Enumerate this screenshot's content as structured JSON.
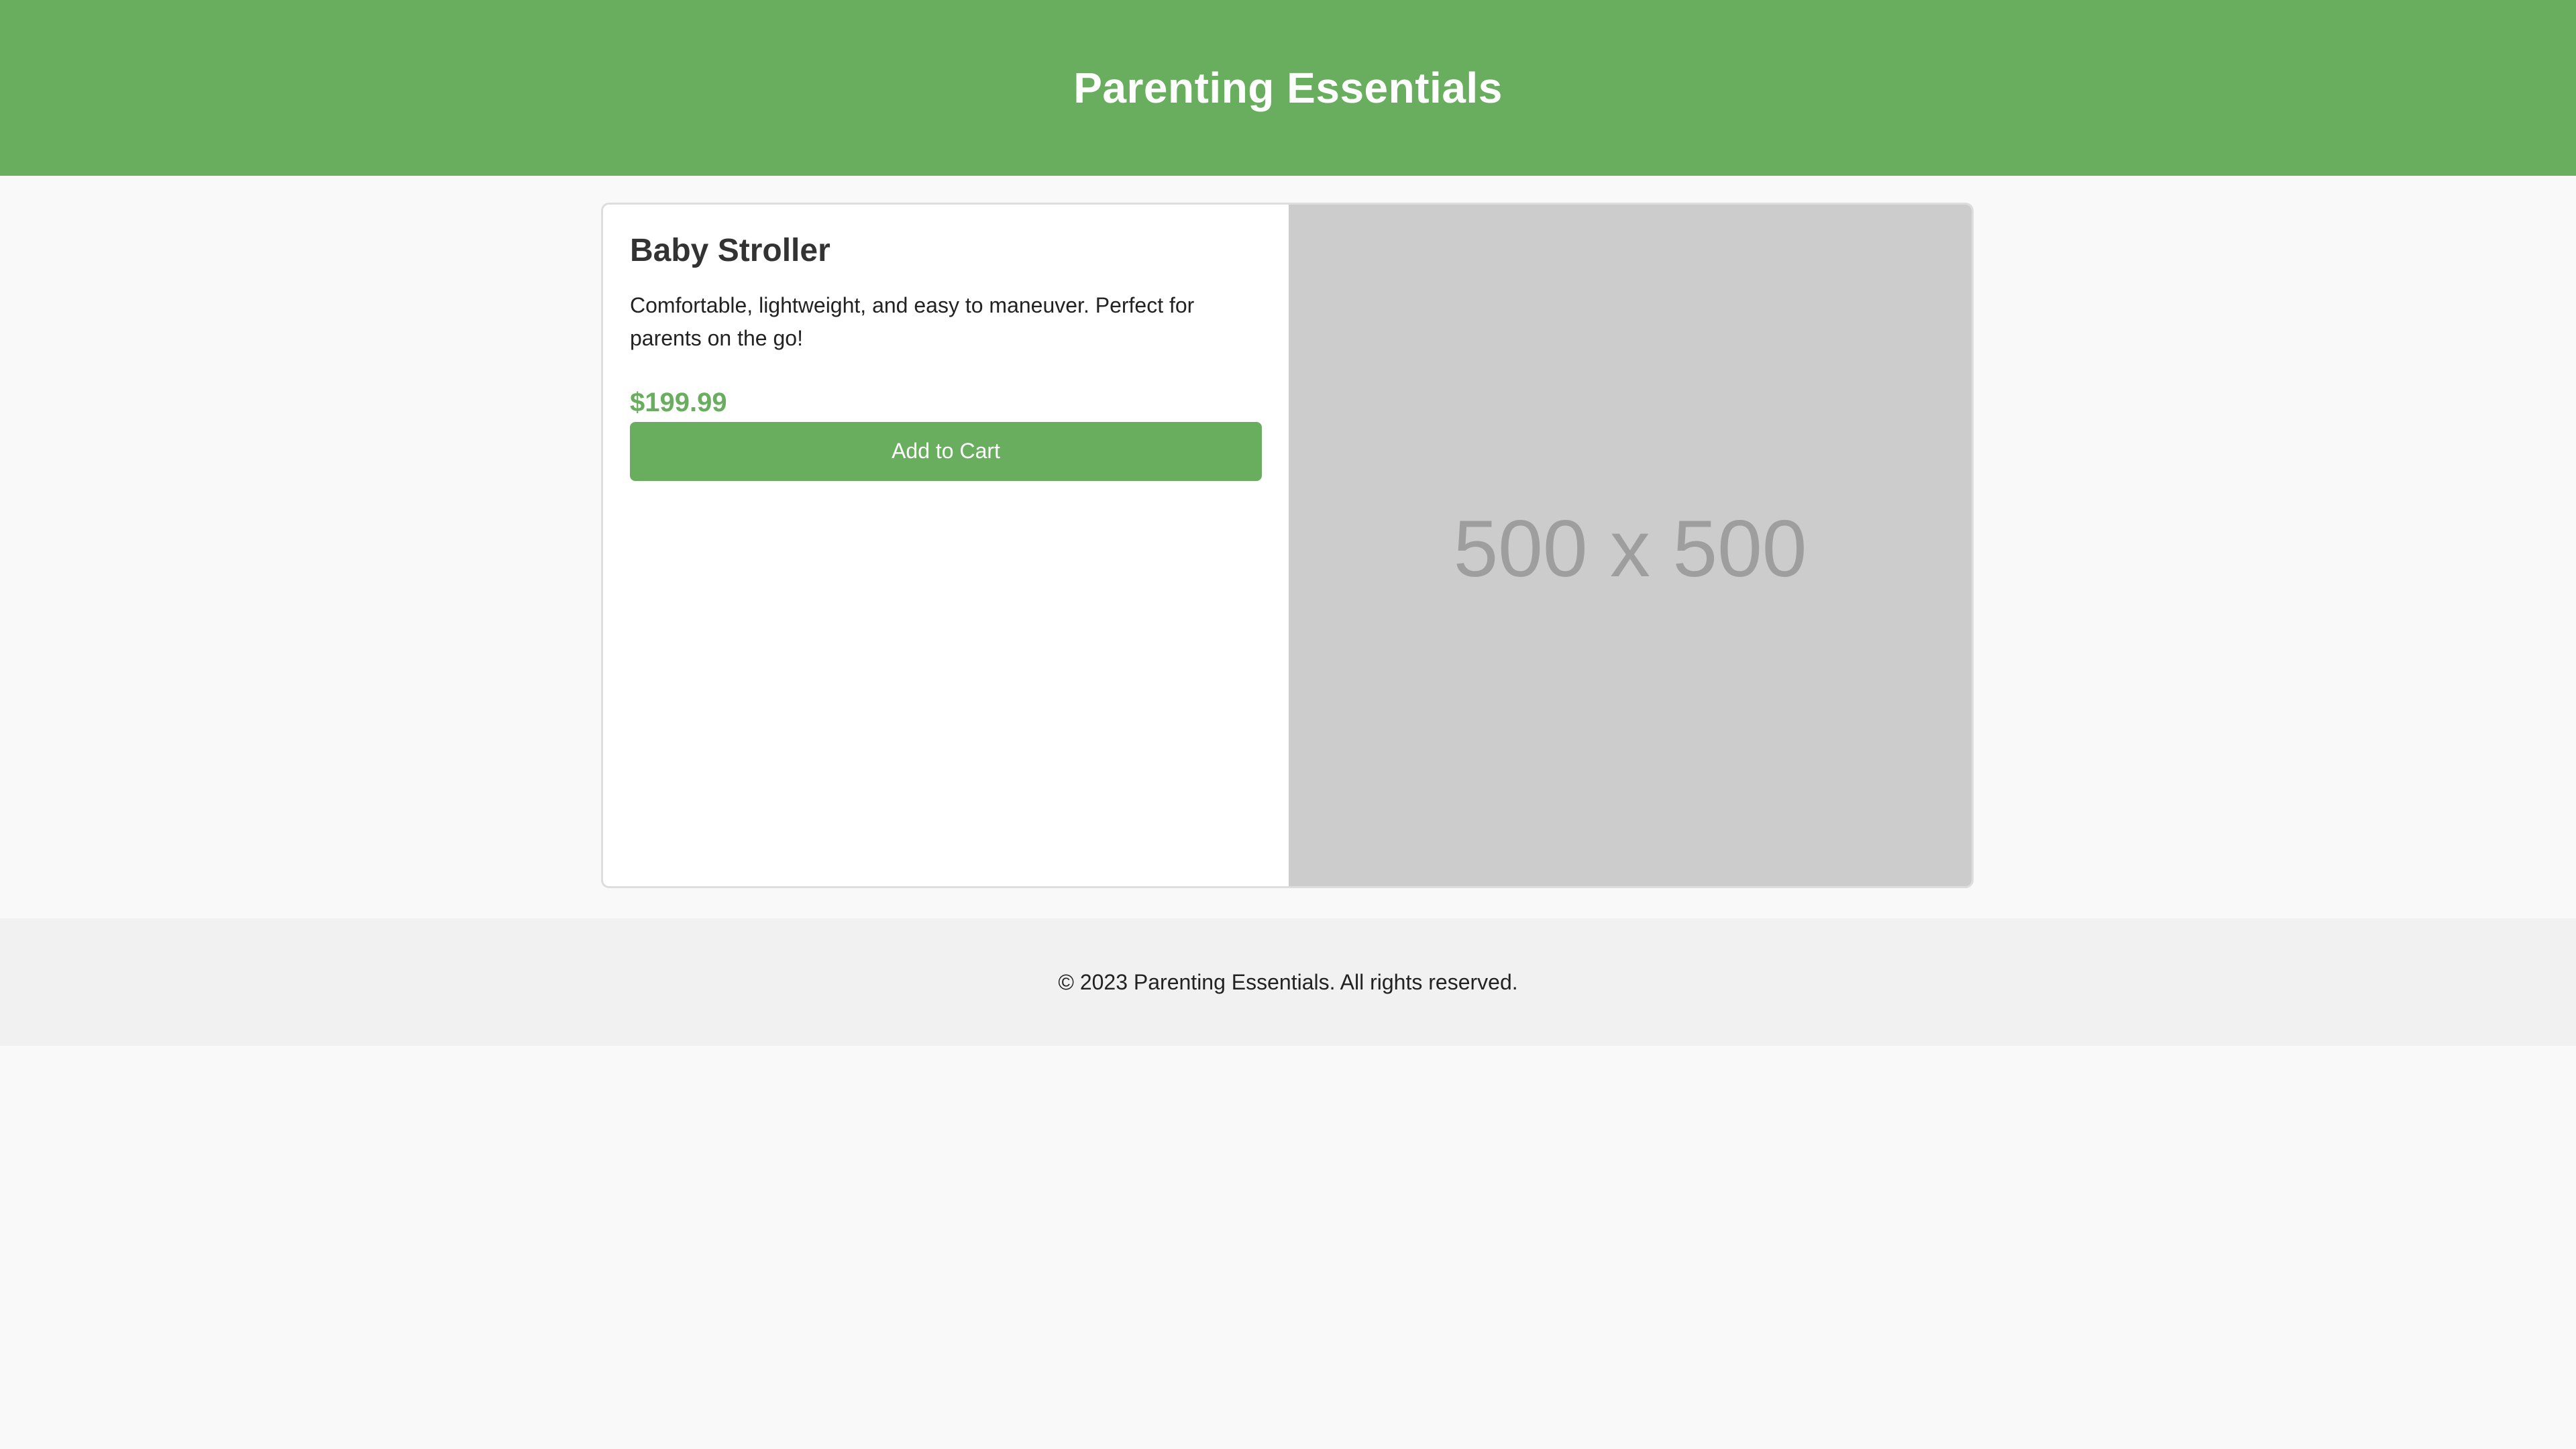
{
  "header": {
    "title": "Parenting Essentials"
  },
  "product": {
    "name": "Baby Stroller",
    "description": "Comfortable, lightweight, and easy to maneuver. Perfect for parents on the go!",
    "price": "$199.99",
    "add_to_cart_label": "Add to Cart",
    "image_placeholder_text": "500 x 500"
  },
  "footer": {
    "copyright": "© 2023 Parenting Essentials. All rights reserved."
  },
  "colors": {
    "brand_green": "#69ae5e",
    "background": "#f9f9f9",
    "footer_bg": "#f1f1f1",
    "placeholder_bg": "#cccccc"
  }
}
